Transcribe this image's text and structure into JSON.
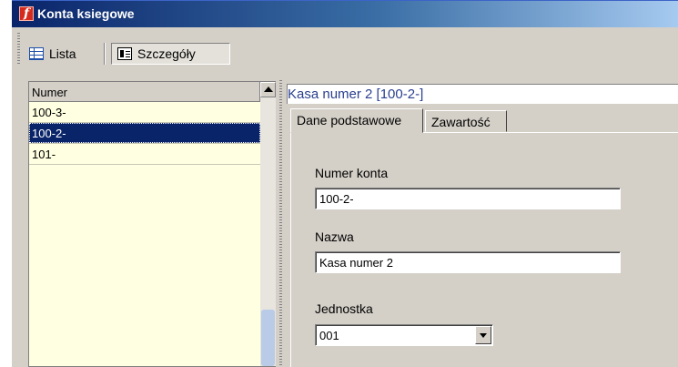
{
  "window": {
    "title": "Konta ksiegowe",
    "app_icon": "f"
  },
  "toolbar": {
    "lista_label": "Lista",
    "szczegoly_label": "Szczegóły"
  },
  "list": {
    "column_header": "Numer",
    "rows": [
      "100-3-",
      "100-2-",
      "101-"
    ],
    "selected_index": 1
  },
  "detail": {
    "title": "Kasa numer 2 [100-2-]",
    "tabs": [
      "Dane podstawowe",
      "Zawartość"
    ],
    "active_tab": "Dane podstawowe",
    "numer_konta": {
      "label": "Numer konta",
      "value": "100-2-"
    },
    "nazwa": {
      "label": "Nazwa",
      "value": "Kasa numer 2"
    },
    "jednostka": {
      "label": "Jednostka",
      "value": "001"
    }
  },
  "colors": {
    "selection": "#0a246a",
    "list_background": "#ffffe1",
    "title_text": "#2a3f8f"
  }
}
